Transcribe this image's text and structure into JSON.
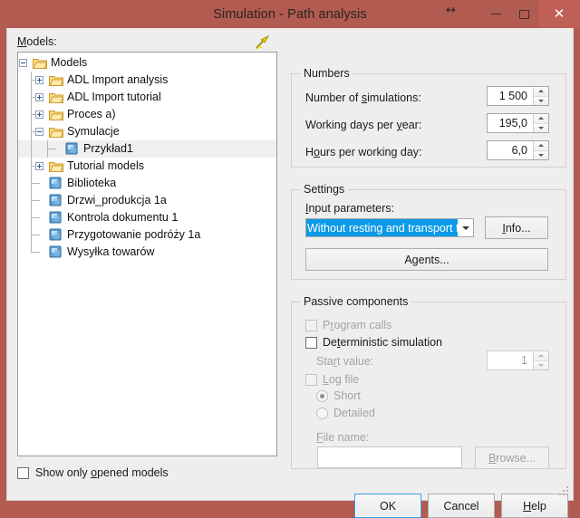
{
  "window": {
    "title": "Simulation - Path analysis",
    "titlebar_color": "#b25b51",
    "close_button_color": "#bf5f55",
    "caption": {
      "resize_cursor": "↔",
      "minimize_name": "minimize-button",
      "maximize_name": "maximize-button",
      "close_glyph": "✕"
    }
  },
  "left": {
    "models_label": "Models:",
    "bolt_icon": "lightning-bolt-icon",
    "tree": [
      {
        "label": "Models",
        "depth": 0,
        "icon": "folder",
        "expander": "minus",
        "selected": false
      },
      {
        "label": "ADL Import analysis",
        "depth": 1,
        "icon": "folder",
        "expander": "plus",
        "selected": false
      },
      {
        "label": "ADL Import tutorial",
        "depth": 1,
        "icon": "folder",
        "expander": "plus",
        "selected": false
      },
      {
        "label": "Proces a)",
        "depth": 1,
        "icon": "folder",
        "expander": "plus",
        "selected": false
      },
      {
        "label": "Symulacje",
        "depth": 1,
        "icon": "folder",
        "expander": "minus",
        "selected": false
      },
      {
        "label": "Przykład1",
        "depth": 2,
        "icon": "doc",
        "expander": "none",
        "selected": true
      },
      {
        "label": "Tutorial models",
        "depth": 1,
        "icon": "folder",
        "expander": "plus",
        "selected": false
      },
      {
        "label": "Biblioteka",
        "depth": 1,
        "icon": "doc",
        "expander": "none",
        "selected": false
      },
      {
        "label": "Drzwi_produkcja 1a",
        "depth": 1,
        "icon": "doc",
        "expander": "none",
        "selected": false
      },
      {
        "label": "Kontrola dokumentu 1",
        "depth": 1,
        "icon": "doc",
        "expander": "none",
        "selected": false
      },
      {
        "label": "Przygotowanie podróży 1a",
        "depth": 1,
        "icon": "doc",
        "expander": "none",
        "selected": false
      },
      {
        "label": "Wysyłka towarów",
        "depth": 1,
        "icon": "doc",
        "expander": "none",
        "selected": false
      }
    ],
    "show_only_opened": {
      "label": "Show only opened models",
      "checked": false
    }
  },
  "numbers": {
    "group_title": "Numbers",
    "fields": [
      {
        "label": "Number of simulations:",
        "value": "1 500",
        "enabled": true
      },
      {
        "label": "Working days per year:",
        "value": "195,0",
        "enabled": true
      },
      {
        "label": "Hours per working day:",
        "value": "6,0",
        "enabled": true
      }
    ]
  },
  "settings": {
    "group_title": "Settings",
    "input_parameters_label": "Input parameters:",
    "combo_value": "Without resting and transport ti",
    "combo_selected": true,
    "highlight_color": "#0c9ae8",
    "info_button": "Info...",
    "agents_button": "Agents..."
  },
  "passive": {
    "group_title": "Passive components",
    "program_calls": {
      "label": "Program calls",
      "checked": false,
      "enabled": false
    },
    "deterministic": {
      "label": "Deterministic simulation",
      "checked": false,
      "enabled": true
    },
    "start_value": {
      "label": "Start value:",
      "value": "1",
      "enabled": false
    },
    "log_file": {
      "label": "Log file",
      "checked": false,
      "enabled": false
    },
    "radio_short": {
      "label": "Short",
      "selected": true,
      "enabled": false
    },
    "radio_detailed": {
      "label": "Detailed",
      "selected": false,
      "enabled": false
    },
    "file_name_label": "File name:",
    "file_name_value": "",
    "browse_button": "Browse..."
  },
  "footer": {
    "ok": "OK",
    "cancel": "Cancel",
    "help": "Help"
  }
}
